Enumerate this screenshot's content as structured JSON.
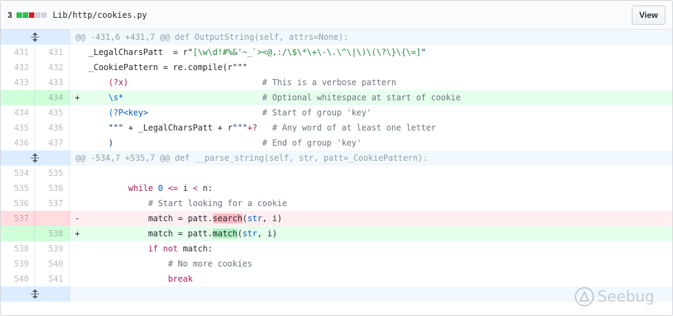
{
  "header": {
    "diffstat_count": "3",
    "diffstat_colors": [
      "#2cbe4e",
      "#2cbe4e",
      "#cb2431",
      "#d1d5da",
      "#d1d5da"
    ],
    "file_path": "Lib/http/cookies.py",
    "view_label": "View"
  },
  "hunks": [
    {
      "header": "@@ -431,6 +431,7 @@ def OutputString(self, attrs=None):",
      "lines": [
        {
          "type": "ctx",
          "old": "431",
          "new": "431"
        },
        {
          "type": "ctx",
          "old": "432",
          "new": "432"
        },
        {
          "type": "ctx",
          "old": "433",
          "new": "433"
        },
        {
          "type": "add",
          "old": "",
          "new": "434",
          "marker": "+"
        },
        {
          "type": "ctx",
          "old": "434",
          "new": "435"
        },
        {
          "type": "ctx",
          "old": "435",
          "new": "436"
        },
        {
          "type": "ctx",
          "old": "436",
          "new": "437"
        }
      ]
    },
    {
      "header": "@@ -534,7 +535,7 @@ def __parse_string(self, str, patt=_CookiePattern):",
      "lines": [
        {
          "type": "ctx",
          "old": "534",
          "new": "535"
        },
        {
          "type": "ctx",
          "old": "535",
          "new": "536"
        },
        {
          "type": "ctx",
          "old": "536",
          "new": "537"
        },
        {
          "type": "del",
          "old": "537",
          "new": "",
          "marker": "-"
        },
        {
          "type": "add",
          "old": "",
          "new": "538",
          "marker": "+"
        },
        {
          "type": "ctx",
          "old": "538",
          "new": "539"
        },
        {
          "type": "ctx",
          "old": "539",
          "new": "540"
        },
        {
          "type": "ctx",
          "old": "540",
          "new": "541"
        }
      ]
    }
  ],
  "code": {
    "h1": {
      "l1_a": "_LegalCharsPatt  = r\"",
      "l1_b": "[\\w\\d!#%&'~_`><@,:/\\$\\*\\+\\-\\.\\^\\|\\)\\(\\?\\}\\{\\=]",
      "l1_c": "\"",
      "l2_a": "_CookiePattern = re.compile(r\"\"\"",
      "l3_a": "(?x)",
      "l3_cmt": "# This is a verbose pattern",
      "l4_a": "\\s*",
      "l4_cmt": "# Optional whitespace at start of cookie",
      "l5_a": "(?P<key>",
      "l5_cmt": "# Start of group 'key'",
      "l6_a": "\"\"\"",
      "l6_b": " + _LegalCharsPatt + ",
      "l6_c": "r\"\"\"",
      "l6_d": "+?",
      "l6_cmt": "# Any word of at least one letter",
      "l7_a": ")",
      "l7_cmt": "# End of group 'key'"
    },
    "h2": {
      "l2_kw": "while",
      "l2_num": "0",
      "l2_op1": "<=",
      "l2_mid": "i",
      "l2_op2": "<",
      "l2_end": "n:",
      "l3_cmt": "# Start looking for a cookie",
      "l4_a": "match = patt.",
      "l4_hl": "search",
      "l4_b": "(",
      "l4_bi": "str",
      "l4_c": ", i)",
      "l5_a": "match = patt.",
      "l5_hl": "match",
      "l5_b": "(",
      "l5_bi": "str",
      "l5_c": ", i)",
      "l6_kw1": "if",
      "l6_kw2": "not",
      "l6_rest": "match:",
      "l7_cmt": "# No more cookies",
      "l8_kw": "break"
    }
  },
  "watermark": {
    "text": "Seebug"
  }
}
